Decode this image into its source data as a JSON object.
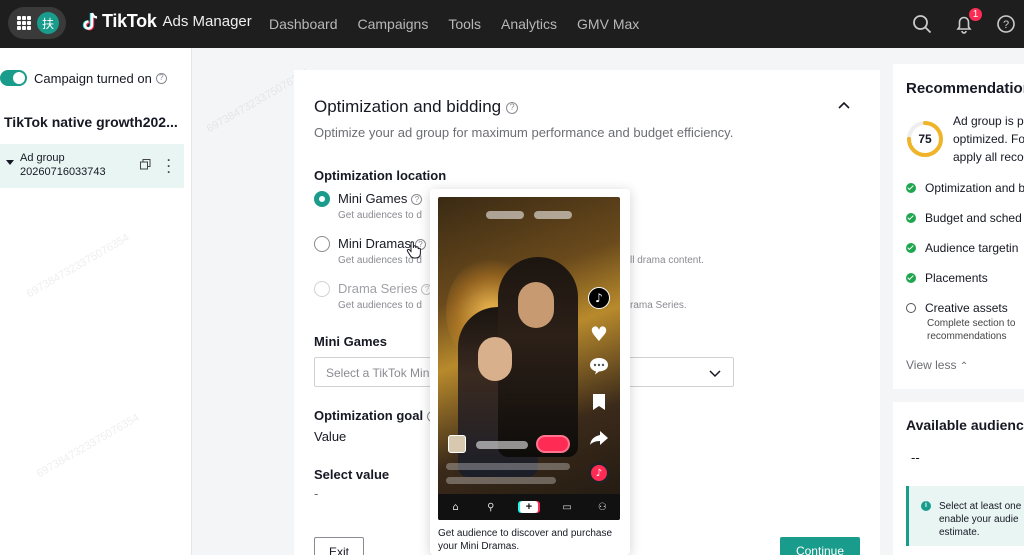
{
  "topbar": {
    "avatar_initial": "扶",
    "brand": "TikTok",
    "brand_sub": "Ads Manager",
    "nav": [
      "Dashboard",
      "Campaigns",
      "Tools",
      "Analytics",
      "GMV Max"
    ],
    "notification_count": "1"
  },
  "sidebar": {
    "toggle_label": "Campaign turned on",
    "campaign_name": "TikTok native growth202...",
    "adgroup_name": "Ad group 20260716033743"
  },
  "main": {
    "section_title": "Optimization and bidding",
    "section_desc": "Optimize your ad group for maximum performance and budget efficiency.",
    "location_label": "Optimization location",
    "options": [
      {
        "label": "Mini Games",
        "desc": "Get audiences to d",
        "checked": true,
        "disabled": false
      },
      {
        "label": "Mini Dramas",
        "desc": "Get audiences to d",
        "desc_tail": "ll drama content.",
        "checked": false,
        "disabled": false
      },
      {
        "label": "Drama Series",
        "desc": "Get audiences to d",
        "desc_tail": "rama Series.",
        "checked": false,
        "disabled": true
      }
    ],
    "mini_games_label": "Mini Games",
    "select_placeholder": "Select a TikTok Min",
    "goal_label": "Optimization goal",
    "goal_value": "Value",
    "select_value_label": "Select value",
    "select_value_value": "-"
  },
  "preview": {
    "caption": "Get audience to discover and purchase your Mini Dramas."
  },
  "footer": {
    "exit_label": "Exit",
    "continue_label": "Continue"
  },
  "recommendations": {
    "title": "Recommendation",
    "score": "75",
    "score_fraction": 0.75,
    "desc_lines": [
      "Ad group is p",
      "optimized. Fo",
      "apply all reco"
    ],
    "items": [
      {
        "label": "Optimization and b",
        "done": true
      },
      {
        "label": "Budget and sched",
        "done": true
      },
      {
        "label": "Audience targetin",
        "done": true
      },
      {
        "label": "Placements",
        "done": true
      },
      {
        "label": "Creative assets",
        "done": false,
        "sub": [
          "Complete section to",
          "recommendations"
        ]
      }
    ],
    "view_less": "View less"
  },
  "audience": {
    "title": "Available audience",
    "value": "--",
    "info_lines": [
      "Select at least one",
      "enable your audie",
      "estimate."
    ]
  },
  "watermark": "6973847323375076354",
  "colors": {
    "accent": "#1a9c8c",
    "topbar": "#1e1e1e",
    "badge": "#fe2c55",
    "check": "#1fa74f",
    "score_ring": "#f0b429"
  }
}
